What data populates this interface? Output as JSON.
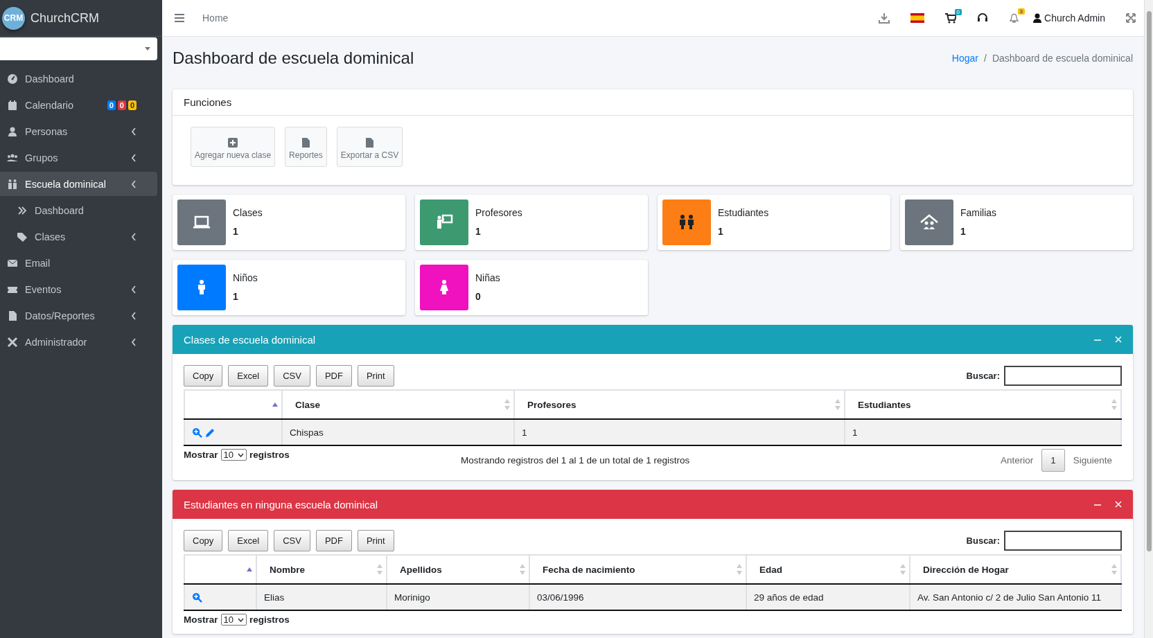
{
  "brand": {
    "logo": "CRM",
    "name": "ChurchCRM"
  },
  "sidebar": {
    "items": [
      {
        "label": "Dashboard",
        "selected": false,
        "expandable": false
      },
      {
        "label": "Calendario",
        "selected": false,
        "expandable": false,
        "badges": [
          {
            "text": "0",
            "color": "#007bff"
          },
          {
            "text": "0",
            "color": "#dc3545"
          },
          {
            "text": "0",
            "color": "#ffc107"
          }
        ]
      },
      {
        "label": "Personas",
        "selected": false,
        "expandable": true
      },
      {
        "label": "Grupos",
        "selected": false,
        "expandable": true
      },
      {
        "label": "Escuela dominical",
        "selected": true,
        "expandable": true,
        "children": [
          {
            "label": "Dashboard",
            "selected": false,
            "expandable": false
          },
          {
            "label": "Clases",
            "selected": false,
            "expandable": true
          }
        ]
      },
      {
        "label": "Email",
        "selected": false,
        "expandable": false
      },
      {
        "label": "Eventos",
        "selected": false,
        "expandable": true
      },
      {
        "label": "Datos/Reportes",
        "selected": false,
        "expandable": true
      },
      {
        "label": "Administrador",
        "selected": false,
        "expandable": true
      }
    ]
  },
  "topbar": {
    "home": "Home",
    "cart_count": "0",
    "notifications": "3",
    "user": "Church Admin"
  },
  "page": {
    "title": "Dashboard de escuela dominical",
    "breadcrumb_separator": "/",
    "breadcrumb": [
      {
        "label": "Hogar",
        "link": true
      },
      {
        "label": "Dashboard de escuela dominical",
        "link": false
      }
    ]
  },
  "functions": {
    "title": "Funciones",
    "buttons": [
      {
        "label": "Agregar nueva clase"
      },
      {
        "label": "Reportes"
      },
      {
        "label": "Exportar a CSV"
      }
    ]
  },
  "stats": [
    {
      "label": "Clases",
      "value": "1",
      "color": "#6c757d"
    },
    {
      "label": "Profesores",
      "value": "1",
      "color": "#3d9970"
    },
    {
      "label": "Estudiantes",
      "value": "1",
      "color": "#fd7e14"
    },
    {
      "label": "Familias",
      "value": "1",
      "color": "#6c757d"
    },
    {
      "label": "Niños",
      "value": "1",
      "color": "#007bff"
    },
    {
      "label": "Niñas",
      "value": "0",
      "color": "#f012be"
    }
  ],
  "tables": [
    {
      "title": "Clases de escuela dominical",
      "color": "#17a2b8",
      "exports": [
        "Copy",
        "Excel",
        "CSV",
        "PDF",
        "Print"
      ],
      "search_label": "Buscar:",
      "actions_column_sorted": true,
      "columns": [
        {
          "label": "Clase",
          "sorted": false
        },
        {
          "label": "Profesores",
          "sorted": false
        },
        {
          "label": "Estudiantes",
          "sorted": false
        }
      ],
      "rows": [
        {
          "editable": true,
          "cells": [
            "Chispas",
            "1",
            "1"
          ]
        }
      ],
      "length_before": "Mostrar",
      "length": "10",
      "length_after": "registros",
      "info": "Mostrando registros del 1 al 1 de un total de 1 registros",
      "pager": {
        "previous": "Anterior",
        "page": "1",
        "next": "Siguiente"
      }
    },
    {
      "title": "Estudiantes en ninguna escuela dominical",
      "color": "#dc3545",
      "exports": [
        "Copy",
        "Excel",
        "CSV",
        "PDF",
        "Print"
      ],
      "search_label": "Buscar:",
      "actions_column_sorted": true,
      "columns": [
        {
          "label": "Nombre",
          "sorted": false
        },
        {
          "label": "Apellidos",
          "sorted": false
        },
        {
          "label": "Fecha de nacimiento",
          "sorted": false
        },
        {
          "label": "Edad",
          "sorted": false
        },
        {
          "label": "Dirección de Hogar",
          "sorted": false
        }
      ],
      "rows": [
        {
          "editable": false,
          "cells": [
            "Elias",
            "Morinigo",
            "03/06/1996",
            "29 años de edad",
            "Av. San Antonio c/ 2 de Julio San Antonio 11"
          ]
        }
      ],
      "length_before": "Mostrar",
      "length": "10",
      "length_after": "registros"
    }
  ]
}
